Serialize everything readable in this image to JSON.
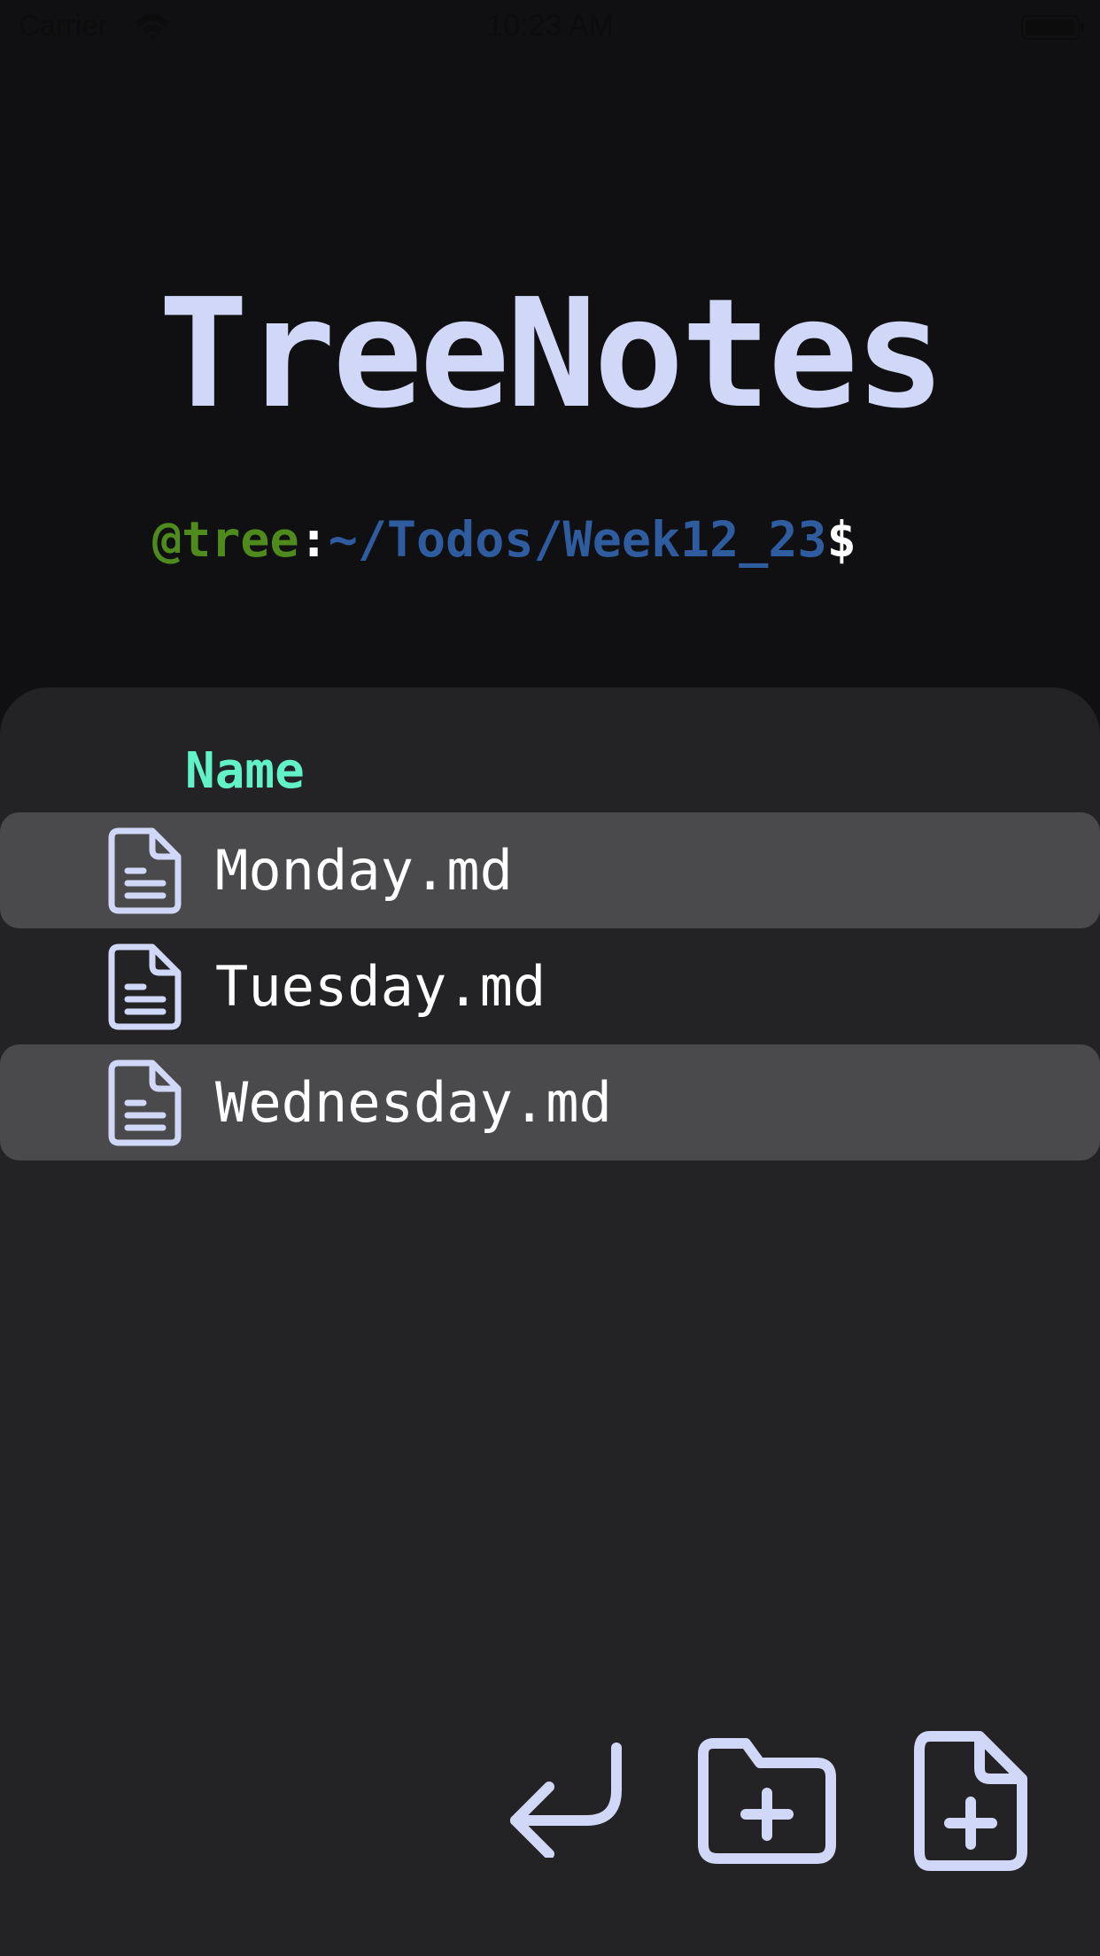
{
  "status_bar": {
    "carrier": "Carrier",
    "time": "10:23 AM",
    "wifi_icon": "wifi-icon",
    "battery_icon": "battery-icon"
  },
  "header": {
    "title": "TreeNotes",
    "prompt": {
      "user": "@tree",
      "separator": ":",
      "path": "~/Todos/Week12_23",
      "symbol": "$"
    }
  },
  "file_list": {
    "column_header": "Name",
    "items": [
      {
        "name": "Monday.md",
        "icon": "document-icon",
        "highlighted": true
      },
      {
        "name": "Tuesday.md",
        "icon": "document-icon",
        "highlighted": false
      },
      {
        "name": "Wednesday.md",
        "icon": "document-icon",
        "highlighted": true
      }
    ]
  },
  "actions": [
    {
      "name": "back",
      "icon": "return-arrow-icon"
    },
    {
      "name": "new-folder",
      "icon": "folder-plus-icon"
    },
    {
      "name": "new-file",
      "icon": "file-plus-icon"
    }
  ],
  "colors": {
    "background": "#101012",
    "panel": "#232325",
    "row_highlight": "#4a4a4c",
    "title": "#d1d8f7",
    "prompt_user": "#4e8a1c",
    "prompt_path": "#2f5c9e",
    "column_header": "#62f2c8",
    "icon": "#d1d8f7"
  }
}
